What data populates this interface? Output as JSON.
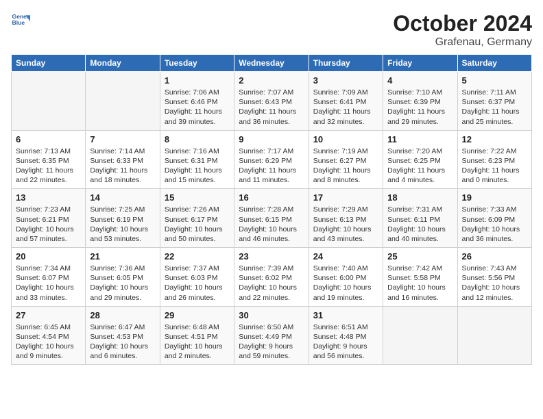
{
  "logo": {
    "line1": "General",
    "line2": "Blue"
  },
  "title": "October 2024",
  "subtitle": "Grafenau, Germany",
  "days_of_week": [
    "Sunday",
    "Monday",
    "Tuesday",
    "Wednesday",
    "Thursday",
    "Friday",
    "Saturday"
  ],
  "weeks": [
    [
      {
        "date": "",
        "info": ""
      },
      {
        "date": "",
        "info": ""
      },
      {
        "date": "1",
        "info": "Sunrise: 7:06 AM\nSunset: 6:46 PM\nDaylight: 11 hours and 39 minutes."
      },
      {
        "date": "2",
        "info": "Sunrise: 7:07 AM\nSunset: 6:43 PM\nDaylight: 11 hours and 36 minutes."
      },
      {
        "date": "3",
        "info": "Sunrise: 7:09 AM\nSunset: 6:41 PM\nDaylight: 11 hours and 32 minutes."
      },
      {
        "date": "4",
        "info": "Sunrise: 7:10 AM\nSunset: 6:39 PM\nDaylight: 11 hours and 29 minutes."
      },
      {
        "date": "5",
        "info": "Sunrise: 7:11 AM\nSunset: 6:37 PM\nDaylight: 11 hours and 25 minutes."
      }
    ],
    [
      {
        "date": "6",
        "info": "Sunrise: 7:13 AM\nSunset: 6:35 PM\nDaylight: 11 hours and 22 minutes."
      },
      {
        "date": "7",
        "info": "Sunrise: 7:14 AM\nSunset: 6:33 PM\nDaylight: 11 hours and 18 minutes."
      },
      {
        "date": "8",
        "info": "Sunrise: 7:16 AM\nSunset: 6:31 PM\nDaylight: 11 hours and 15 minutes."
      },
      {
        "date": "9",
        "info": "Sunrise: 7:17 AM\nSunset: 6:29 PM\nDaylight: 11 hours and 11 minutes."
      },
      {
        "date": "10",
        "info": "Sunrise: 7:19 AM\nSunset: 6:27 PM\nDaylight: 11 hours and 8 minutes."
      },
      {
        "date": "11",
        "info": "Sunrise: 7:20 AM\nSunset: 6:25 PM\nDaylight: 11 hours and 4 minutes."
      },
      {
        "date": "12",
        "info": "Sunrise: 7:22 AM\nSunset: 6:23 PM\nDaylight: 11 hours and 0 minutes."
      }
    ],
    [
      {
        "date": "13",
        "info": "Sunrise: 7:23 AM\nSunset: 6:21 PM\nDaylight: 10 hours and 57 minutes."
      },
      {
        "date": "14",
        "info": "Sunrise: 7:25 AM\nSunset: 6:19 PM\nDaylight: 10 hours and 53 minutes."
      },
      {
        "date": "15",
        "info": "Sunrise: 7:26 AM\nSunset: 6:17 PM\nDaylight: 10 hours and 50 minutes."
      },
      {
        "date": "16",
        "info": "Sunrise: 7:28 AM\nSunset: 6:15 PM\nDaylight: 10 hours and 46 minutes."
      },
      {
        "date": "17",
        "info": "Sunrise: 7:29 AM\nSunset: 6:13 PM\nDaylight: 10 hours and 43 minutes."
      },
      {
        "date": "18",
        "info": "Sunrise: 7:31 AM\nSunset: 6:11 PM\nDaylight: 10 hours and 40 minutes."
      },
      {
        "date": "19",
        "info": "Sunrise: 7:33 AM\nSunset: 6:09 PM\nDaylight: 10 hours and 36 minutes."
      }
    ],
    [
      {
        "date": "20",
        "info": "Sunrise: 7:34 AM\nSunset: 6:07 PM\nDaylight: 10 hours and 33 minutes."
      },
      {
        "date": "21",
        "info": "Sunrise: 7:36 AM\nSunset: 6:05 PM\nDaylight: 10 hours and 29 minutes."
      },
      {
        "date": "22",
        "info": "Sunrise: 7:37 AM\nSunset: 6:03 PM\nDaylight: 10 hours and 26 minutes."
      },
      {
        "date": "23",
        "info": "Sunrise: 7:39 AM\nSunset: 6:02 PM\nDaylight: 10 hours and 22 minutes."
      },
      {
        "date": "24",
        "info": "Sunrise: 7:40 AM\nSunset: 6:00 PM\nDaylight: 10 hours and 19 minutes."
      },
      {
        "date": "25",
        "info": "Sunrise: 7:42 AM\nSunset: 5:58 PM\nDaylight: 10 hours and 16 minutes."
      },
      {
        "date": "26",
        "info": "Sunrise: 7:43 AM\nSunset: 5:56 PM\nDaylight: 10 hours and 12 minutes."
      }
    ],
    [
      {
        "date": "27",
        "info": "Sunrise: 6:45 AM\nSunset: 4:54 PM\nDaylight: 10 hours and 9 minutes."
      },
      {
        "date": "28",
        "info": "Sunrise: 6:47 AM\nSunset: 4:53 PM\nDaylight: 10 hours and 6 minutes."
      },
      {
        "date": "29",
        "info": "Sunrise: 6:48 AM\nSunset: 4:51 PM\nDaylight: 10 hours and 2 minutes."
      },
      {
        "date": "30",
        "info": "Sunrise: 6:50 AM\nSunset: 4:49 PM\nDaylight: 9 hours and 59 minutes."
      },
      {
        "date": "31",
        "info": "Sunrise: 6:51 AM\nSunset: 4:48 PM\nDaylight: 9 hours and 56 minutes."
      },
      {
        "date": "",
        "info": ""
      },
      {
        "date": "",
        "info": ""
      }
    ]
  ]
}
